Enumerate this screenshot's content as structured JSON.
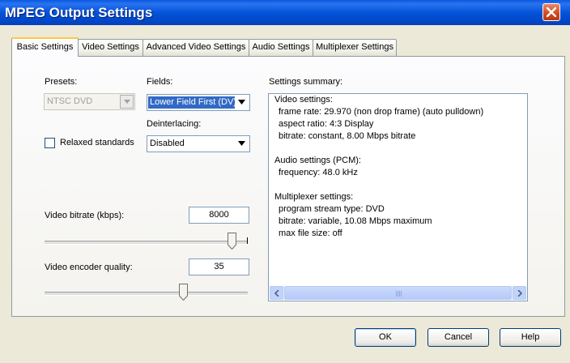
{
  "window": {
    "title": "MPEG Output Settings"
  },
  "tabs": [
    {
      "label": "Basic Settings",
      "active": true
    },
    {
      "label": "Video Settings"
    },
    {
      "label": "Advanced Video Settings"
    },
    {
      "label": "Audio Settings"
    },
    {
      "label": "Multiplexer Settings"
    }
  ],
  "presets": {
    "label": "Presets:",
    "value": "NTSC DVD"
  },
  "fields": {
    "label": "Fields:",
    "value": "Lower Field First (DV)"
  },
  "deinterlacing": {
    "label": "Deinterlacing:",
    "value": "Disabled"
  },
  "relaxed": {
    "label": "Relaxed standards",
    "checked": false
  },
  "bitrate": {
    "label": "Video bitrate (kbps):",
    "value": "8000",
    "slider_fraction": 0.94
  },
  "quality": {
    "label": "Video encoder quality:",
    "value": "35",
    "slider_fraction": 0.69
  },
  "summary": {
    "label": "Settings summary:",
    "lines": [
      "Video settings:",
      "frame rate: 29.970 (non drop frame) (auto pulldown)",
      "aspect ratio: 4:3 Display",
      "bitrate: constant, 8.00 Mbps bitrate",
      "",
      "Audio settings (PCM):",
      "frequency: 48.0 kHz",
      "",
      "Multiplexer settings:",
      "program stream type: DVD",
      "bitrate: variable, 10.08 Mbps maximum",
      "max file size: off"
    ]
  },
  "buttons": {
    "ok": "OK",
    "cancel": "Cancel",
    "help": "Help"
  }
}
